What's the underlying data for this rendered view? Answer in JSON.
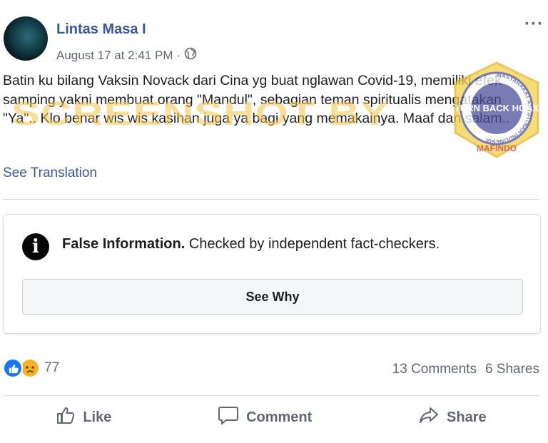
{
  "post": {
    "author": "Lintas Masa I",
    "timestamp": "August 17 at 2:41 PM",
    "separator": "·",
    "privacy_icon": "globe-icon",
    "more_label": "···",
    "text": "Batin ku bilang Vaksin Novack dari Cina yg buat nglawan Covid-19, memiliki efek samping yakni membuat orang \"Mandul\", sebagian teman spiritualis mengatakan \"Ya\".. Klo benar wis wis kasihan juga ya bagi yang memakainya. Maaf dan salam..",
    "see_translation": "See Translation"
  },
  "watermark": {
    "text": "SCREENSHOT BY",
    "badge_top": "TURN BACK HOAX",
    "badge_ring": "MASYARAKAT ANTIFITNAH INDONESIA",
    "badge_bottom": "MAFINDO"
  },
  "fact_check": {
    "title": "False Information.",
    "description": "Checked by independent fact-checkers.",
    "button_label": "See Why",
    "icon": "info-icon"
  },
  "engagement": {
    "reaction_count": "77",
    "comments": "13 Comments",
    "shares": "6 Shares"
  },
  "actions": {
    "like": "Like",
    "comment": "Comment",
    "share": "Share"
  },
  "colors": {
    "link": "#385898",
    "like_blue": "#1877f2",
    "watermark": "#f4c24a"
  }
}
